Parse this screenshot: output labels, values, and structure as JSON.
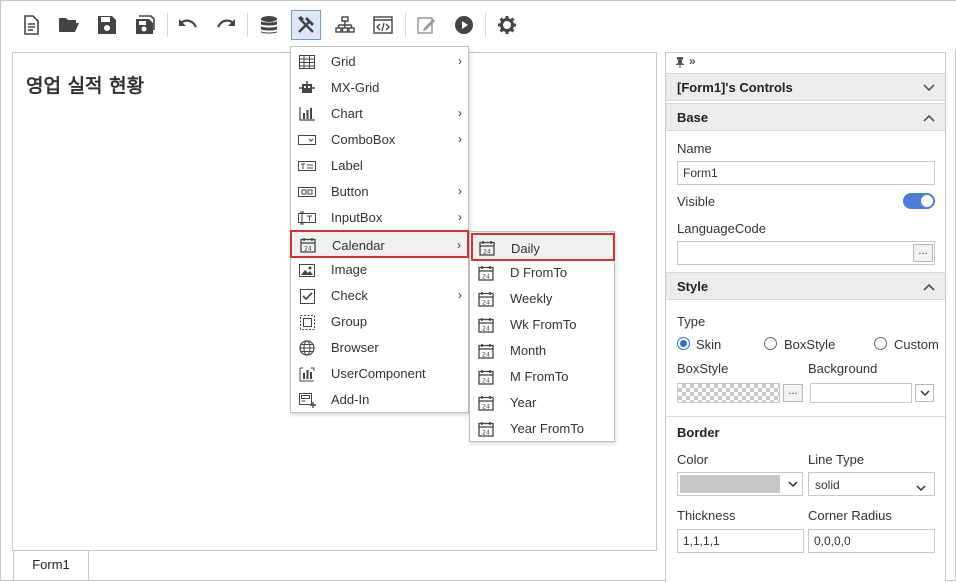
{
  "toolbar": {
    "buttons": [
      "new-file",
      "open-folder",
      "save",
      "save-all",
      "undo",
      "redo",
      "database",
      "tools",
      "hierarchy",
      "code",
      "edit",
      "run",
      "settings"
    ]
  },
  "form": {
    "title": "영업 실적 현황",
    "tab_label": "Form1"
  },
  "controls_menu": {
    "items": [
      {
        "label": "Grid",
        "icon": "grid-icon",
        "submenu": true
      },
      {
        "label": "MX-Grid",
        "icon": "mx-grid-icon",
        "submenu": false
      },
      {
        "label": "Chart",
        "icon": "chart-icon",
        "submenu": true
      },
      {
        "label": "ComboBox",
        "icon": "combobox-icon",
        "submenu": true
      },
      {
        "label": "Label",
        "icon": "label-icon",
        "submenu": false
      },
      {
        "label": "Button",
        "icon": "button-icon",
        "submenu": true
      },
      {
        "label": "InputBox",
        "icon": "inputbox-icon",
        "submenu": true
      },
      {
        "label": "Calendar",
        "icon": "calendar-icon",
        "submenu": true,
        "highlighted": true
      },
      {
        "label": "Image",
        "icon": "image-icon",
        "submenu": false
      },
      {
        "label": "Check",
        "icon": "check-icon",
        "submenu": true
      },
      {
        "label": "Group",
        "icon": "group-icon",
        "submenu": false
      },
      {
        "label": "Browser",
        "icon": "globe-icon",
        "submenu": false
      },
      {
        "label": "UserComponent",
        "icon": "user-component-icon",
        "submenu": false
      },
      {
        "label": "Add-In",
        "icon": "add-in-icon",
        "submenu": false
      }
    ]
  },
  "calendar_submenu": {
    "items": [
      {
        "label": "Daily",
        "highlighted": true
      },
      {
        "label": "D FromTo"
      },
      {
        "label": "Weekly"
      },
      {
        "label": "Wk FromTo"
      },
      {
        "label": "Month"
      },
      {
        "label": "M FromTo"
      },
      {
        "label": "Year"
      },
      {
        "label": "Year FromTo"
      }
    ]
  },
  "panel": {
    "header": "[Form1]'s Controls",
    "base": {
      "section_label": "Base",
      "name_label": "Name",
      "name_value": "Form1",
      "visible_label": "Visible",
      "visible_on": true,
      "language_label": "LanguageCode",
      "language_value": "",
      "dots": "..."
    },
    "style": {
      "section_label": "Style",
      "type_label": "Type",
      "type_options": [
        "Skin",
        "BoxStyle",
        "Custom"
      ],
      "type_selected": "Skin",
      "boxstyle_label": "BoxStyle",
      "background_label": "Background",
      "dots": "..."
    },
    "border": {
      "section_label": "Border",
      "color_label": "Color",
      "line_type_label": "Line Type",
      "line_type_value": "solid",
      "thickness_label": "Thickness",
      "thickness_value": "1,1,1,1",
      "radius_label": "Corner Radius",
      "radius_value": "0,0,0,0"
    }
  },
  "colors": {
    "accent": "#4e7cd9",
    "highlight_border": "#d93030",
    "header_bg": "#ececec"
  }
}
